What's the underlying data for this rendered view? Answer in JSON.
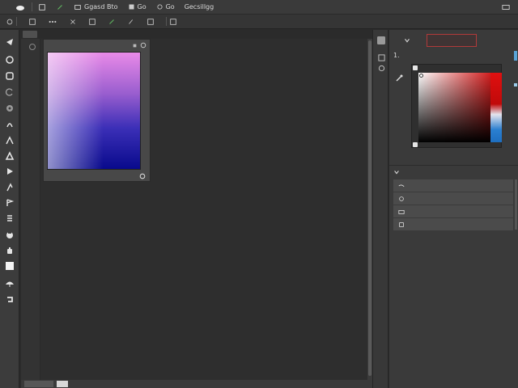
{
  "menubar": {
    "items": [
      {
        "label": "",
        "icon": "logo-icon"
      },
      {
        "label": "",
        "icon": "cloud-icon"
      },
      {
        "label": "",
        "icon": "brush-icon"
      },
      {
        "label": "",
        "icon": "image-icon"
      },
      {
        "label": "Ggasd Bto",
        "icon": "layers-icon"
      },
      {
        "label": "Go",
        "icon": "type-icon"
      },
      {
        "label": "Go",
        "icon": "filter-icon"
      },
      {
        "label": "Gecsillgg",
        "icon": ""
      }
    ]
  },
  "options_bar": {
    "items": [
      {
        "label": "",
        "icon": "circle-icon"
      },
      {
        "label": "",
        "icon": "square-icon"
      },
      {
        "label": "",
        "icon": "dots-icon"
      },
      {
        "label": "",
        "icon": "move-icon"
      },
      {
        "label": "",
        "icon": "grid-icon"
      },
      {
        "label": "",
        "icon": "brush-icon"
      },
      {
        "label": "",
        "icon": "pen-icon"
      },
      {
        "label": "",
        "icon": "grid-icon"
      },
      {
        "label": "",
        "icon": "table-icon"
      }
    ]
  },
  "swatch_panel": {
    "title": "",
    "footer_label": ""
  },
  "color_panel": {
    "tabs": [
      {
        "label": "",
        "icon": "adjust-icon"
      },
      {
        "label": ""
      }
    ],
    "title": "1. "
  },
  "layers_section": {
    "title": "",
    "rows": [
      {
        "icon": "curve-icon",
        "label": ""
      },
      {
        "icon": "circle-arrow-icon",
        "label": ""
      },
      {
        "icon": "folder-icon",
        "label": ""
      },
      {
        "icon": "page-icon",
        "label": ""
      }
    ]
  },
  "colors": {
    "bg": "#2b2b2b",
    "accent_red": "#b13a3a",
    "scroll_blue": "#5aa4d8"
  }
}
